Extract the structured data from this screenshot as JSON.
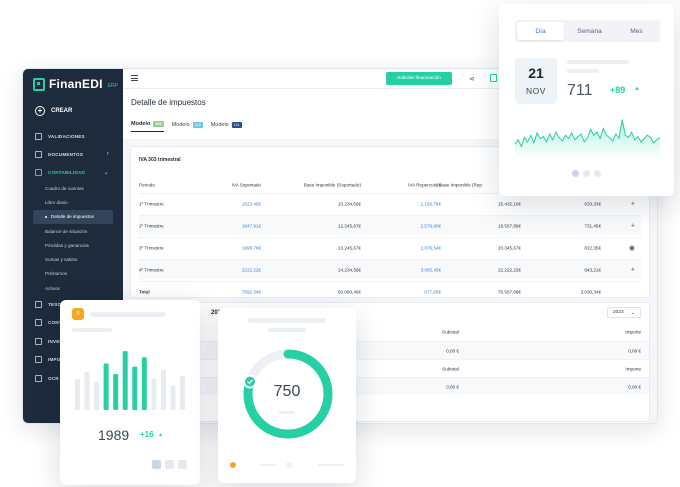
{
  "colors": {
    "accent": "#25d0a4",
    "sidebar": "#1d2b3d",
    "link": "#2f7fd6",
    "badge": "#f5a623"
  },
  "brand": {
    "name": "FinanEDI",
    "suffix": "ERP"
  },
  "sidebar": {
    "create_label": "CREAR",
    "items": [
      {
        "label": "VALIDACIONES",
        "icon": "validations-icon"
      },
      {
        "label": "DOCUMENTOS",
        "icon": "documents-icon",
        "chevron": "›"
      },
      {
        "label": "CONTABILIDAD",
        "icon": "accounting-icon",
        "chevron": "⌄"
      }
    ],
    "sub_items": [
      "Cuadro de cuentas",
      "Libro diario",
      "Detalle de impuestos",
      "Balance de situación",
      "Pérdidas y ganancias",
      "Sumas y saldos",
      "Préstamos",
      "Activos"
    ],
    "lower_items": [
      "TESO",
      "CONT",
      "INVEN",
      "IMPO",
      "OCR"
    ]
  },
  "topbar": {
    "finance_button": "Solicitar financiación"
  },
  "page": {
    "title": "Detalle de impuestos",
    "tabs": [
      {
        "label": "Modelo",
        "tag": "303",
        "tag_color": "#8fd18a"
      },
      {
        "label": "Modelo",
        "tag": "115",
        "tag_color": "#6fc7d9"
      },
      {
        "label": "Modelo",
        "tag": "111",
        "tag_color": "#2b4e8c"
      }
    ]
  },
  "iva_table": {
    "title": "IVA 303 trimestral",
    "headers": [
      "Periodo",
      "IVA Soportado",
      "Base Imponible (Soportado)",
      "IVA Repercutido",
      "Base Imponible (Rep"
    ],
    "rows": [
      {
        "period": "1º Trimestre",
        "iva_sop": "1523.45€",
        "base_sop": "10.234,56€",
        "iva_rep": "2.156,78€",
        "base_rep": "15.432,10€",
        "result": "633,33€",
        "action": "+"
      },
      {
        "period": "2º Trimestre",
        "iva_sop": "1847.91€",
        "base_sop": "12.345,67€",
        "iva_rep": "2.578,90€",
        "base_rep": "18.567,89€",
        "result": "731,45€",
        "action": "+"
      },
      {
        "period": "3º Trimestre",
        "iva_sop": "1998.76€",
        "base_sop": "13.245,67€",
        "iva_rep": "2.876,54€",
        "base_rep": "20.345,67€",
        "result": "822,35€",
        "action": "◉"
      },
      {
        "period": "4º Trimestre",
        "iva_sop": "2222.22€",
        "base_sop": "14.234,56€",
        "iva_rep": "3.065,43€",
        "base_rep": "22.222,22€",
        "result": "843,21€",
        "action": "+"
      }
    ],
    "total": {
      "label": "Total",
      "iva_sop": "7592.34€",
      "base_sop": "50.060,46€",
      "iva_rep": "677,65€",
      "base_rep": "76.567,88€",
      "result": "3.030,34€"
    }
  },
  "second_card": {
    "title_fragment": "2023",
    "year": "2023",
    "headers": [
      "Subtotal",
      "Importe"
    ],
    "rows": [
      {
        "subtotal": "0,00 €",
        "importe": "0,00 €"
      },
      {
        "subtotal": "Subtotal",
        "importe": "Importe"
      },
      {
        "subtotal": "0,00 €",
        "importe": "0,00 €"
      }
    ]
  },
  "calendar_widget": {
    "tabs": [
      "Día",
      "Semana",
      "Mes"
    ],
    "day": "21",
    "month": "NOV",
    "value": "711",
    "delta": "+89",
    "sparkline": [
      0.35,
      0.45,
      0.3,
      0.5,
      0.4,
      0.55,
      0.38,
      0.6,
      0.48,
      0.52,
      0.4,
      0.58,
      0.45,
      0.62,
      0.5,
      0.42,
      0.55,
      0.48,
      0.6,
      0.45,
      0.52,
      0.58,
      0.4,
      0.5,
      0.68,
      0.55,
      0.62,
      0.48,
      0.7,
      0.55,
      0.5,
      0.42,
      0.58,
      0.48,
      0.9,
      0.55,
      0.5,
      0.62,
      0.45,
      0.52,
      0.4,
      0.48,
      0.55,
      0.5,
      0.38,
      0.45,
      0.5
    ]
  },
  "bar_widget": {
    "value": "1989",
    "delta": "+16",
    "bars": [
      0.5,
      0.62,
      0.45,
      0.75,
      0.58,
      0.95,
      0.7,
      0.85,
      0.5,
      0.65,
      0.4,
      0.55
    ],
    "badge_icon": "chart-badge-icon"
  },
  "gauge_widget": {
    "value": "750",
    "fill": 0.8
  }
}
